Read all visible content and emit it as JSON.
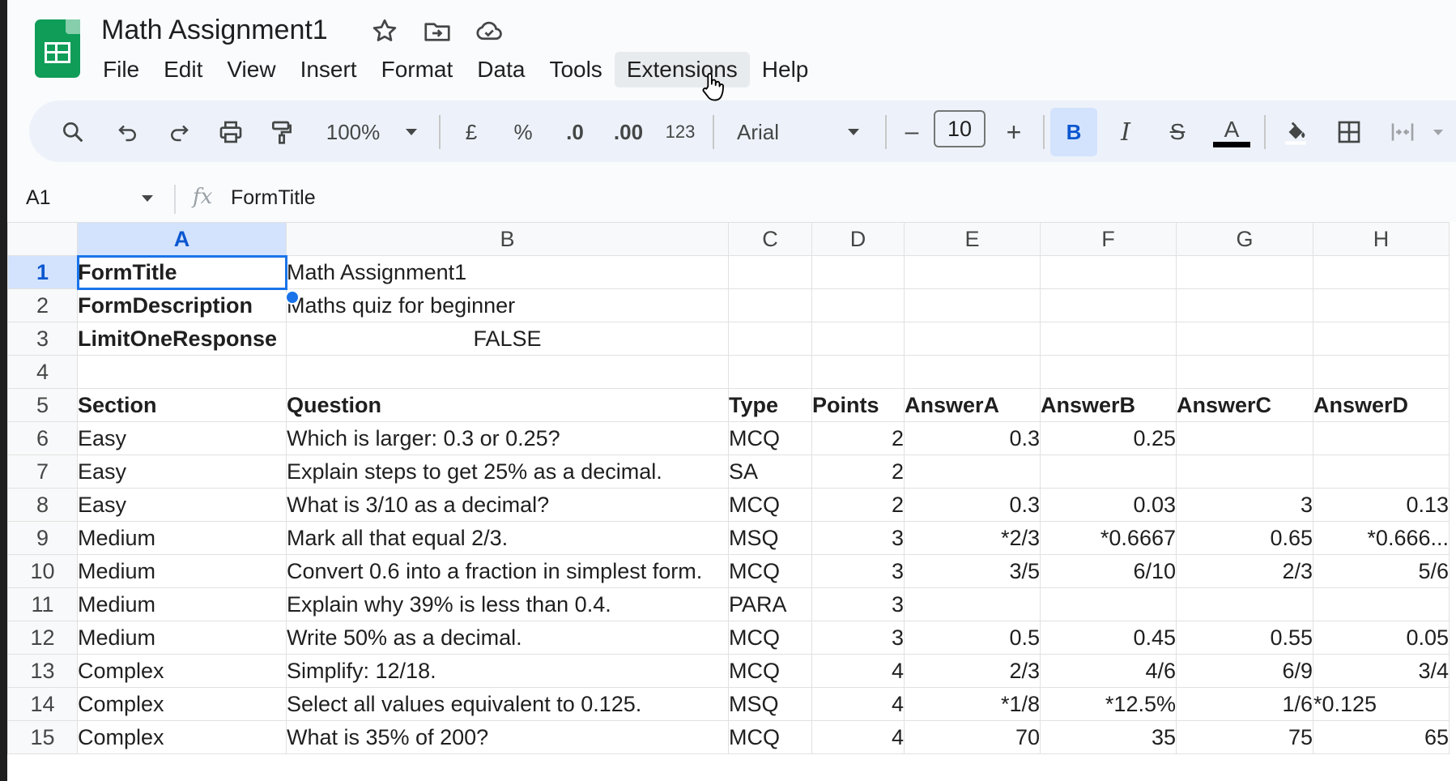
{
  "app": {
    "title": "Math Assignment1",
    "menu": [
      "File",
      "Edit",
      "View",
      "Insert",
      "Format",
      "Data",
      "Tools",
      "Extensions",
      "Help"
    ]
  },
  "toolbar": {
    "zoom": "100%",
    "currency": "£",
    "percent": "%",
    "decrease_decimal": ".0",
    "increase_decimal": ".00",
    "number_format": "123",
    "font": "Arial",
    "font_size": "10",
    "minus": "–",
    "plus": "+",
    "bold": "B",
    "italic": "I",
    "strike": "S",
    "text_color": "A"
  },
  "formula_bar": {
    "cell_ref": "A1",
    "fx": "fx",
    "content": "FormTitle"
  },
  "grid": {
    "columns": [
      "A",
      "B",
      "C",
      "D",
      "E",
      "F",
      "G",
      "H"
    ],
    "rows": [
      [
        "FormTitle",
        "Math Assignment1",
        "",
        "",
        "",
        "",
        "",
        ""
      ],
      [
        "FormDescription",
        "Maths quiz for beginner",
        "",
        "",
        "",
        "",
        "",
        ""
      ],
      [
        "LimitOneResponse",
        "FALSE",
        "",
        "",
        "",
        "",
        "",
        ""
      ],
      [
        "",
        "",
        "",
        "",
        "",
        "",
        "",
        ""
      ],
      [
        "Section",
        "Question",
        "Type",
        "Points",
        "AnswerA",
        "AnswerB",
        "AnswerC",
        "AnswerD"
      ],
      [
        "Easy",
        "Which is larger: 0.3 or 0.25?",
        "MCQ",
        "2",
        "0.3",
        "0.25",
        "",
        ""
      ],
      [
        "Easy",
        "Explain steps to get 25% as a decimal.",
        "SA",
        "2",
        "",
        "",
        "",
        ""
      ],
      [
        "Easy",
        "What is 3/10 as a decimal?",
        "MCQ",
        "2",
        "0.3",
        "0.03",
        "3",
        "0.13"
      ],
      [
        "Medium",
        "Mark all that equal 2/3.",
        "MSQ",
        "3",
        "*2/3",
        "*0.6667",
        "0.65",
        "*0.666..."
      ],
      [
        "Medium",
        "Convert 0.6 into a fraction in simplest form.",
        "MCQ",
        "3",
        "3/5",
        "6/10",
        "2/3",
        "5/6"
      ],
      [
        "Medium",
        "Explain why 39% is less than 0.4.",
        "PARA",
        "3",
        "",
        "",
        "",
        ""
      ],
      [
        "Medium",
        "Write 50% as a decimal.",
        "MCQ",
        "3",
        "0.5",
        "0.45",
        "0.55",
        "0.05"
      ],
      [
        "Complex",
        "Simplify: 12/18.",
        "MCQ",
        "4",
        "2/3",
        "4/6",
        "6/9",
        "3/4"
      ],
      [
        "Complex",
        "Select all values equivalent to 0.125.",
        "MSQ",
        "4",
        "*1/8",
        "*12.5%",
        "1/6",
        "*0.125"
      ],
      [
        "Complex",
        "What is 35% of 200?",
        "MCQ",
        "4",
        "70",
        "35",
        "75",
        "65"
      ]
    ]
  },
  "colors": {
    "accent": "#1a73e8",
    "logo": "#0f9d58",
    "selected_header": "#d3e3fd"
  }
}
